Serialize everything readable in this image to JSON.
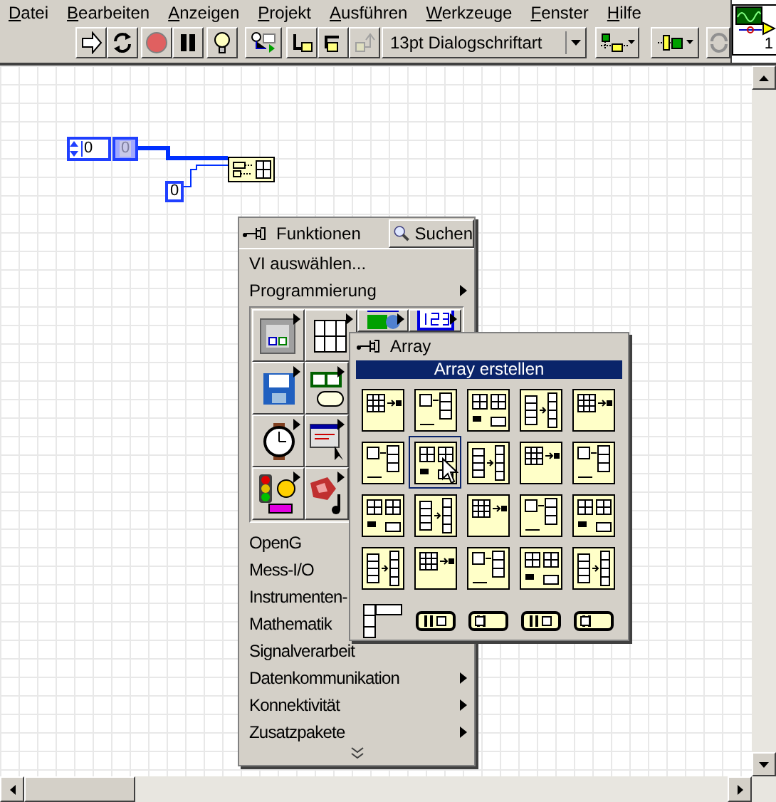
{
  "menu": [
    "Datei",
    "Bearbeiten",
    "Anzeigen",
    "Projekt",
    "Ausführen",
    "Werkzeuge",
    "Fenster",
    "Hilfe"
  ],
  "toolbar": {
    "font": "13pt Dialogschriftart"
  },
  "vi_icon": {
    "connector_label": "1"
  },
  "diagram": {
    "numeric_control": "0",
    "indicator": "0",
    "constant": "0"
  },
  "functions_palette": {
    "title": "Funktionen",
    "search_button": "Suchen",
    "top_items": [
      {
        "label": "VI auswählen...",
        "submenu": false
      },
      {
        "label": "Programmierung",
        "submenu": true
      }
    ],
    "icon_rows": [
      [
        {
          "kind": "structures"
        },
        {
          "kind": "array"
        },
        {
          "kind": "cluster"
        },
        {
          "kind": "numeric"
        }
      ],
      [
        {
          "kind": "file"
        },
        {
          "kind": "boolean"
        }
      ],
      [
        {
          "kind": "timing"
        },
        {
          "kind": "dialog"
        }
      ],
      [
        {
          "kind": "error"
        },
        {
          "kind": "sound"
        }
      ]
    ],
    "items": [
      {
        "label": "OpenG"
      },
      {
        "label": "Mess-I/O"
      },
      {
        "label": "Instrumenten-"
      },
      {
        "label": "Mathematik"
      },
      {
        "label": "Signalverarbeit"
      },
      {
        "label": "Datenkommunikation",
        "submenu": true
      },
      {
        "label": "Konnektivität",
        "submenu": true
      },
      {
        "label": "Zusatzpakete",
        "submenu": true
      }
    ]
  },
  "array_palette": {
    "title": "Array",
    "highlight": "Array erstellen",
    "rows": [
      [
        {
          "kind": "function",
          "selected": false
        },
        {
          "kind": "function",
          "selected": false
        },
        {
          "kind": "function",
          "selected": false
        },
        {
          "kind": "function",
          "selected": false
        },
        {
          "kind": "function",
          "selected": false
        }
      ],
      [
        {
          "kind": "function",
          "selected": false
        },
        {
          "kind": "function",
          "selected": true
        },
        {
          "kind": "function",
          "selected": false
        },
        {
          "kind": "function",
          "selected": false
        },
        {
          "kind": "function",
          "selected": false
        }
      ],
      [
        {
          "kind": "function",
          "selected": false
        },
        {
          "kind": "function",
          "selected": false
        },
        {
          "kind": "function",
          "selected": false
        },
        {
          "kind": "function",
          "selected": false
        },
        {
          "kind": "function",
          "selected": false
        }
      ],
      [
        {
          "kind": "function",
          "selected": false
        },
        {
          "kind": "function",
          "selected": false
        },
        {
          "kind": "function",
          "selected": false
        },
        {
          "kind": "function",
          "selected": false
        },
        {
          "kind": "function",
          "selected": false
        }
      ],
      [
        {
          "kind": "constant",
          "selected": false
        },
        {
          "kind": "constant",
          "selected": false
        },
        {
          "kind": "constant",
          "selected": false
        },
        {
          "kind": "constant",
          "selected": false
        },
        {
          "kind": "constant",
          "selected": false
        }
      ]
    ]
  }
}
